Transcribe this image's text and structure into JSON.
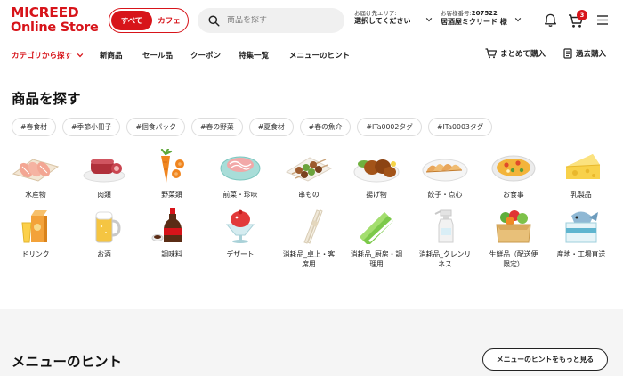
{
  "brand": {
    "logo_line1": "MICREED",
    "logo_line2": "Online Store"
  },
  "mode_toggle": {
    "active": "すべて",
    "inactive": "カフェ"
  },
  "search": {
    "placeholder": "商品を探す"
  },
  "delivery": {
    "label": "お届け先エリア:",
    "value": "選択してください"
  },
  "account": {
    "label": "お客様番号:",
    "number": "207522",
    "name": "居酒屋ミクリード 様"
  },
  "cart": {
    "count": "3"
  },
  "nav": {
    "category_menu": "カテゴリから探す",
    "items": [
      "新商品",
      "セール品",
      "クーポン",
      "特集一覧",
      "メニューのヒント"
    ],
    "bulk_order": "まとめて購入",
    "history": "過去購入"
  },
  "page_title": "商品を探す",
  "tags": [
    "#春食材",
    "#季節小冊子",
    "#個食パック",
    "#春の野菜",
    "#夏食材",
    "#春の魚介",
    "#ITa0002タグ",
    "#ITa0003タグ"
  ],
  "categories": [
    {
      "label": "水産物",
      "icon": "fish-slices-icon"
    },
    {
      "label": "肉類",
      "icon": "meat-icon"
    },
    {
      "label": "野菜類",
      "icon": "carrot-icon"
    },
    {
      "label": "前菜・珍味",
      "icon": "appetizer-icon"
    },
    {
      "label": "串もの",
      "icon": "skewer-icon"
    },
    {
      "label": "揚げ物",
      "icon": "fried-food-icon"
    },
    {
      "label": "餃子・点心",
      "icon": "gyoza-icon"
    },
    {
      "label": "お食事",
      "icon": "paella-icon"
    },
    {
      "label": "乳製品",
      "icon": "cheese-icon"
    },
    {
      "label": "ドリンク",
      "icon": "juice-icon"
    },
    {
      "label": "お酒",
      "icon": "beer-icon"
    },
    {
      "label": "調味料",
      "icon": "soy-sauce-icon"
    },
    {
      "label": "デザート",
      "icon": "dessert-icon"
    },
    {
      "label": "消耗品_卓上・客席用",
      "icon": "chopsticks-icon"
    },
    {
      "label": "消耗品_厨房・調理用",
      "icon": "wrap-icon"
    },
    {
      "label": "消耗品_クレンリネス",
      "icon": "spray-bottle-icon"
    },
    {
      "label": "生鮮品（配送便限定）",
      "icon": "vegetable-box-icon"
    },
    {
      "label": "産地・工場直送",
      "icon": "fish-box-icon"
    }
  ],
  "hints": {
    "title": "メニューのヒント",
    "more_button": "メニューのヒントをもっと見る"
  },
  "colors": {
    "brand_red": "#d7141a",
    "band_gray": "#f5f5f5"
  }
}
